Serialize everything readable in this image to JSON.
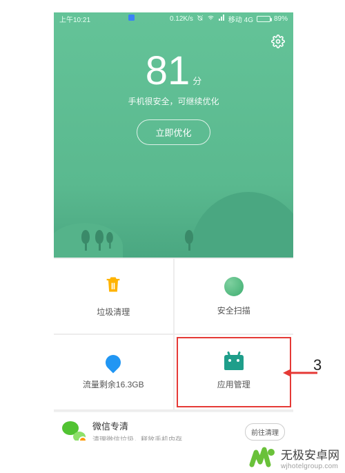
{
  "statusbar": {
    "time": "上午10:21",
    "speed": "0.12K/s",
    "carrier": "移动 4G",
    "battery_pct": "89%"
  },
  "header": {
    "score": "81",
    "score_unit": "分",
    "subtitle": "手机很安全，可继续优化",
    "optimize_label": "立即优化"
  },
  "tiles": {
    "trash": "垃圾清理",
    "scan": "安全扫描",
    "data": "流量剩余16.3GB",
    "apps": "应用管理"
  },
  "promo": {
    "title": "微信专清",
    "subtitle": "清理微信垃圾，释放手机内存",
    "button": "前往清理"
  },
  "annotation": {
    "num": "3"
  },
  "watermark": {
    "name": "无极安卓网",
    "url": "wjhotelgroup.com"
  }
}
